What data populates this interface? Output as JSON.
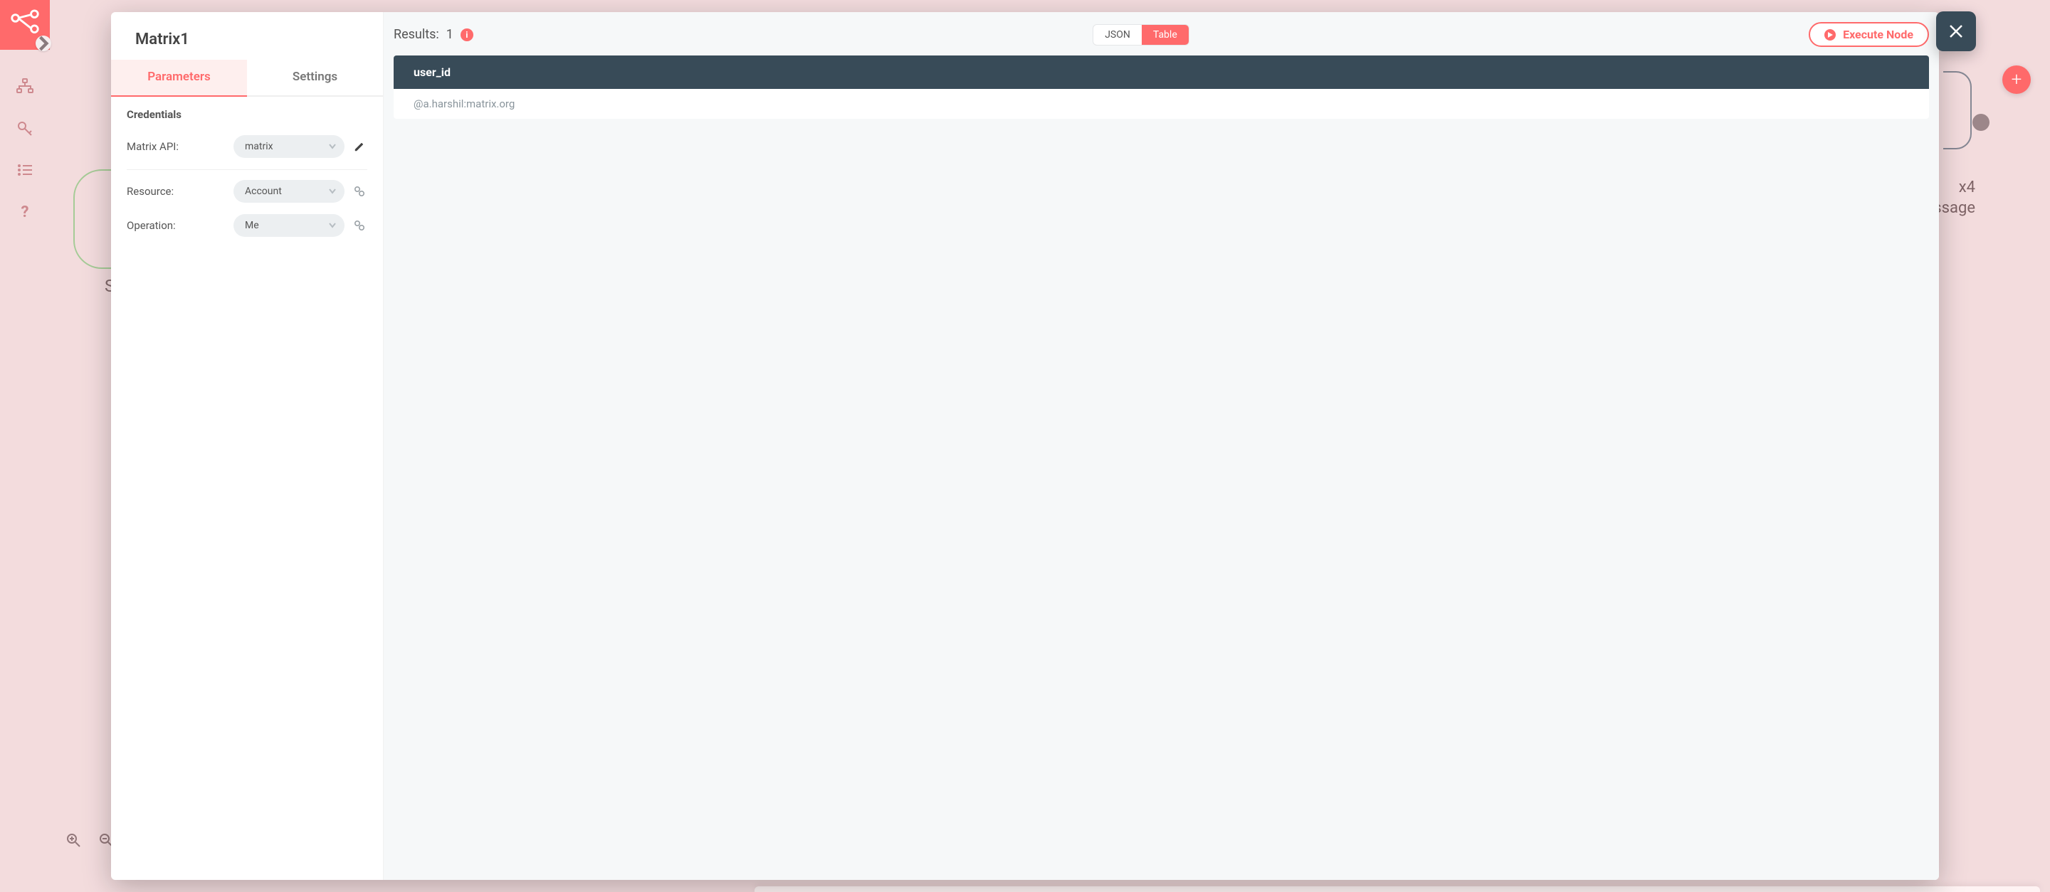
{
  "sidebar": {
    "brand_icon": "workflow-icon",
    "nav": [
      {
        "name": "workflows-icon"
      },
      {
        "name": "key-icon"
      },
      {
        "name": "list-icon"
      },
      {
        "name": "help-icon"
      }
    ]
  },
  "canvas": {
    "start_label": "S",
    "right_node_line1": "x4",
    "right_node_line2": "essage",
    "add_label": "+"
  },
  "modal": {
    "title": "Matrix1",
    "tabs": {
      "parameters": "Parameters",
      "settings": "Settings",
      "active": "parameters"
    },
    "credentials_heading": "Credentials",
    "fields": {
      "matrix_api": {
        "label": "Matrix API:",
        "value": "matrix"
      },
      "resource": {
        "label": "Resource:",
        "value": "Account"
      },
      "operation": {
        "label": "Operation:",
        "value": "Me"
      }
    }
  },
  "results": {
    "label_prefix": "Results:",
    "count": "1",
    "view_toggle": {
      "json": "JSON",
      "table": "Table",
      "active": "table"
    },
    "execute_label": "Execute Node",
    "table": {
      "header": "user_id",
      "rows": [
        "@a.harshil:matrix.org"
      ]
    }
  },
  "colors": {
    "accent": "#ff6a6b",
    "header_dark": "#384b58"
  }
}
